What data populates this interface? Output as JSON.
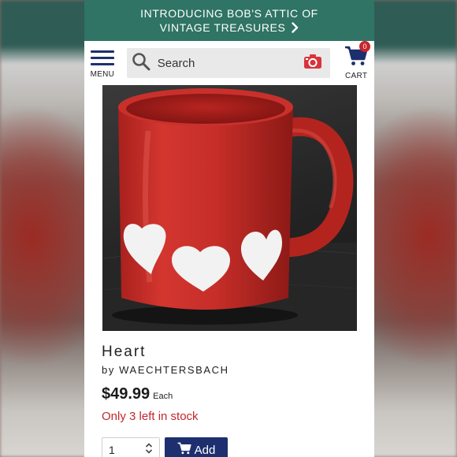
{
  "promo": {
    "line1": "INTRODUCING BOB'S ATTIC OF",
    "line2": "VINTAGE TREASURES"
  },
  "header": {
    "menu_label": "MENU",
    "search_placeholder": "Search",
    "cart_label": "CART",
    "cart_count": "0"
  },
  "product": {
    "name": "Heart",
    "by_prefix": "by",
    "brand": "WAECHTERSBACH",
    "price": "$49.99",
    "price_unit": "Each",
    "stock_note": "Only 3 left in stock",
    "quantity": "1",
    "add_label": "Add"
  },
  "colors": {
    "promo_bg": "#2f7464",
    "brand_navy": "#1d2f6e",
    "alert_red": "#c0282d",
    "mug_red": "#c9302c"
  },
  "icons": [
    "hamburger-menu-icon",
    "search-icon",
    "camera-icon",
    "cart-icon",
    "chevron-right-icon",
    "stepper-icon"
  ]
}
